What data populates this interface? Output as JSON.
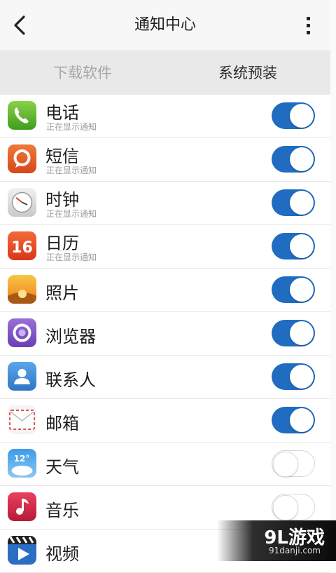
{
  "header": {
    "title": "通知中心",
    "back_icon": "chevron-left-icon",
    "more_icon": "more-vertical-icon"
  },
  "tabs": [
    {
      "label": "下载软件",
      "active": false
    },
    {
      "label": "系统预装",
      "active": true
    }
  ],
  "apps": [
    {
      "name": "电话",
      "status": "正在显示通知",
      "enabled": true,
      "icon": "phone-icon"
    },
    {
      "name": "短信",
      "status": "正在显示通知",
      "enabled": true,
      "icon": "message-icon"
    },
    {
      "name": "时钟",
      "status": "正在显示通知",
      "enabled": true,
      "icon": "clock-icon"
    },
    {
      "name": "日历",
      "status": "正在显示通知",
      "enabled": true,
      "icon": "calendar-icon",
      "icon_text": "16"
    },
    {
      "name": "照片",
      "status": "",
      "enabled": true,
      "icon": "photos-icon"
    },
    {
      "name": "浏览器",
      "status": "",
      "enabled": true,
      "icon": "browser-icon"
    },
    {
      "name": "联系人",
      "status": "",
      "enabled": true,
      "icon": "contacts-icon"
    },
    {
      "name": "邮箱",
      "status": "",
      "enabled": true,
      "icon": "mail-icon"
    },
    {
      "name": "天气",
      "status": "",
      "enabled": false,
      "icon": "weather-icon",
      "icon_text": "12°"
    },
    {
      "name": "音乐",
      "status": "",
      "enabled": false,
      "icon": "music-icon"
    },
    {
      "name": "视频",
      "status": "",
      "enabled": false,
      "icon": "video-icon"
    }
  ],
  "watermark": {
    "logo": "9L游戏",
    "site": "91danji.com"
  },
  "colors": {
    "toggle_on": "#1f6cc0",
    "tab_bar": "#e9e9e9",
    "header": "#f7f7f7"
  }
}
